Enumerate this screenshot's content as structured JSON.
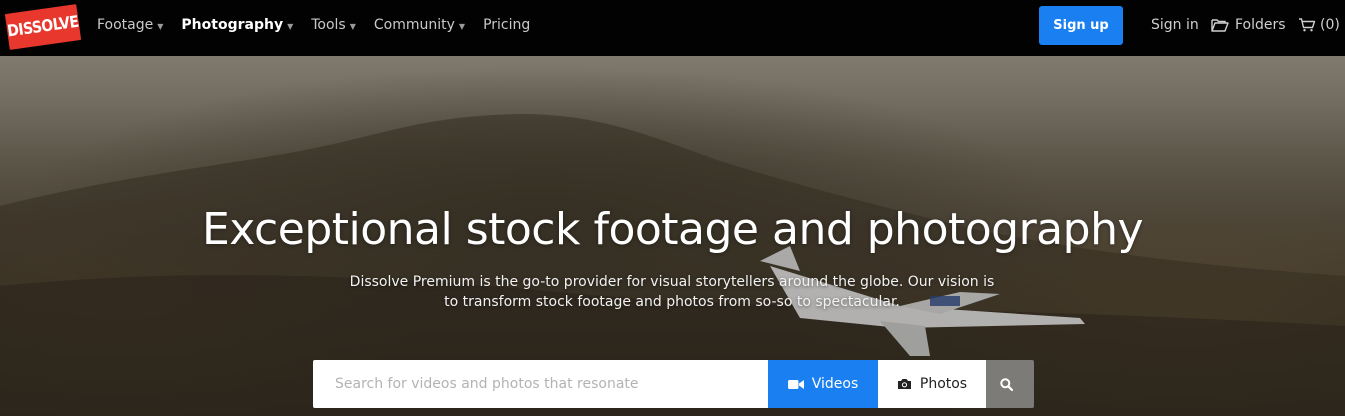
{
  "brand": {
    "logo_text": "DISSOLVE",
    "logo_color": "#e8382e"
  },
  "nav": {
    "items": [
      {
        "label": "Footage",
        "has_dropdown": true,
        "active": false
      },
      {
        "label": "Photography",
        "has_dropdown": true,
        "active": true
      },
      {
        "label": "Tools",
        "has_dropdown": true,
        "active": false
      },
      {
        "label": "Community",
        "has_dropdown": true,
        "active": false
      },
      {
        "label": "Pricing",
        "has_dropdown": false,
        "active": false
      }
    ],
    "signup_label": "Sign up",
    "signin_label": "Sign in",
    "folders_label": "Folders",
    "cart_count": "(0)",
    "icons": {
      "dropdown": "caret-down-icon",
      "folders": "folder-open-icon",
      "cart": "cart-icon"
    }
  },
  "hero": {
    "title": "Exceptional stock footage and photography",
    "subtitle_line1": "Dissolve Premium is the go-to provider for visual storytellers around the globe. Our vision is",
    "subtitle_line2": "to transform stock footage and photos from so-so to spectacular."
  },
  "search": {
    "placeholder": "Search for videos and photos that resonate",
    "value": "",
    "videos_label": "Videos",
    "photos_label": "Photos",
    "selected_type": "Videos",
    "icons": {
      "videos": "video-camera-icon",
      "photos": "camera-icon",
      "submit": "search-icon"
    }
  },
  "colors": {
    "accent": "#1a7ff0",
    "navbar_bg": "#020202",
    "search_submit_bg": "#7d7b78"
  }
}
